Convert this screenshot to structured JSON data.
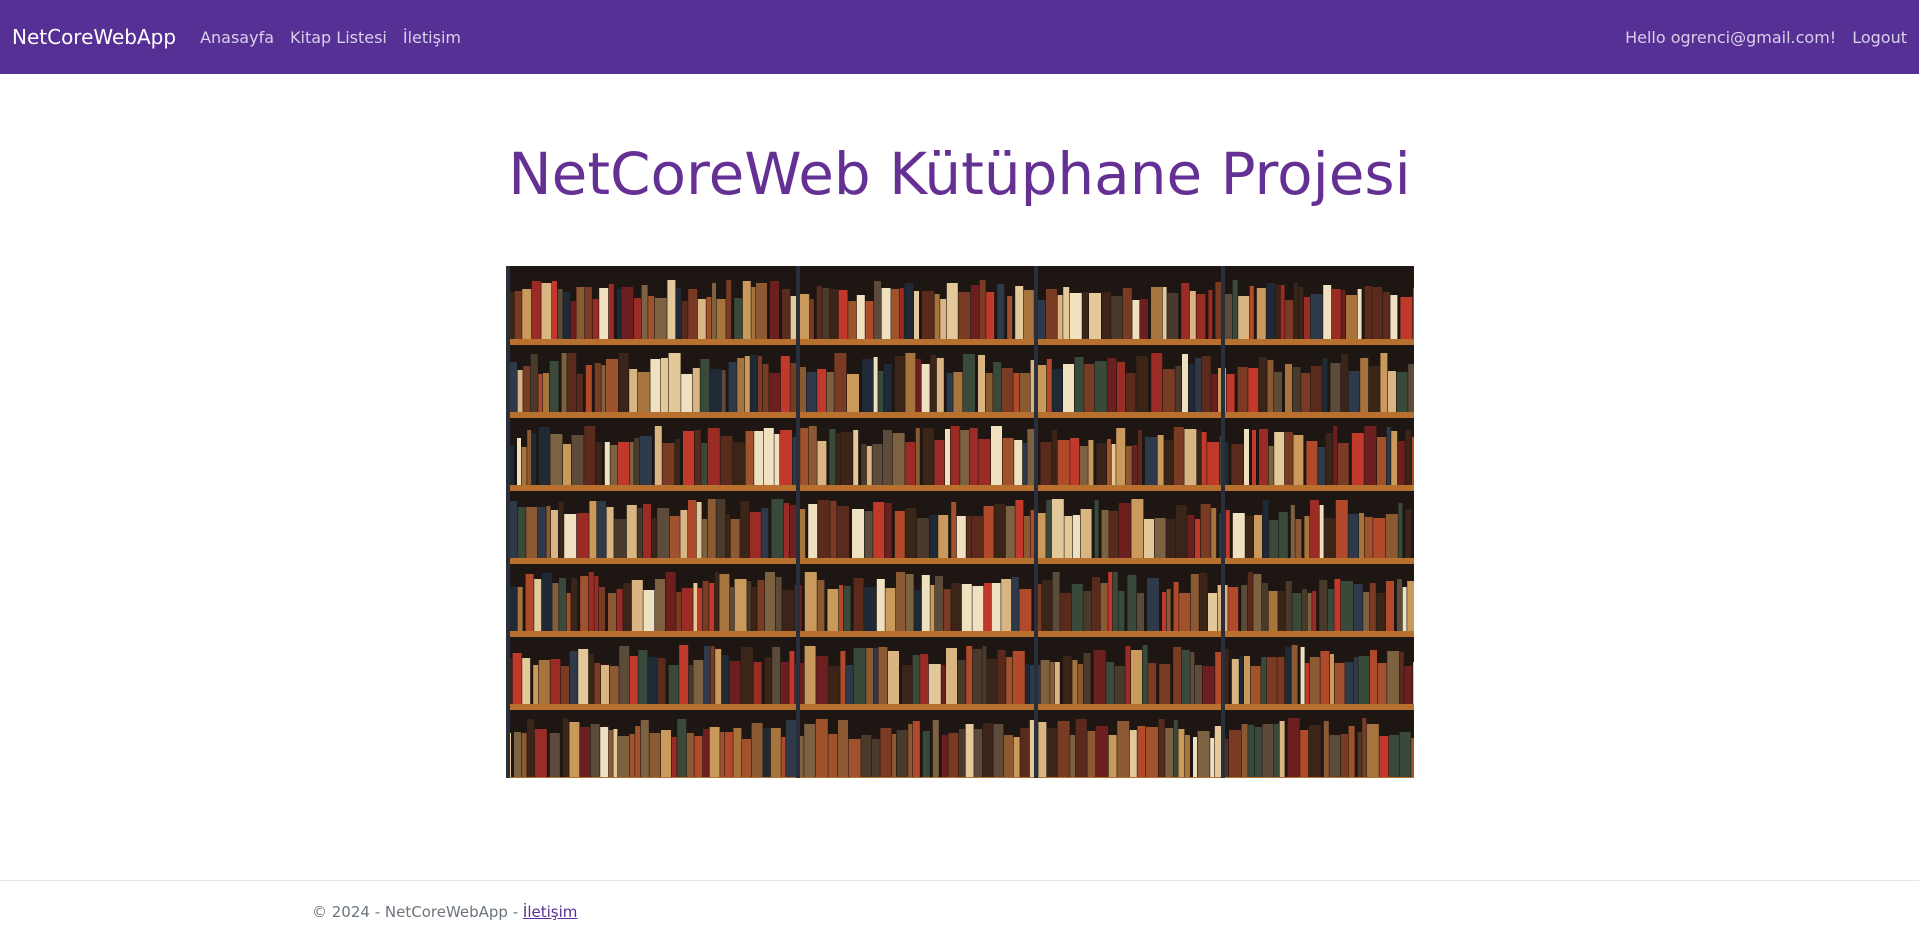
{
  "navbar": {
    "brand": "NetCoreWebApp",
    "links": [
      {
        "label": "Anasayfa"
      },
      {
        "label": "Kitap Listesi"
      },
      {
        "label": "İletişim"
      }
    ],
    "user_greeting": "Hello ogrenci@gmail.com!",
    "logout_label": "Logout",
    "background_color": "#563095"
  },
  "main": {
    "title": "NetCoreWeb Kütüphane Projesi",
    "title_color": "#643094",
    "hero_image": {
      "subject": "bookshelf-full-of-books"
    }
  },
  "footer": {
    "copyright": "© 2024 - NetCoreWebApp - ",
    "link_label": "İletişim"
  }
}
